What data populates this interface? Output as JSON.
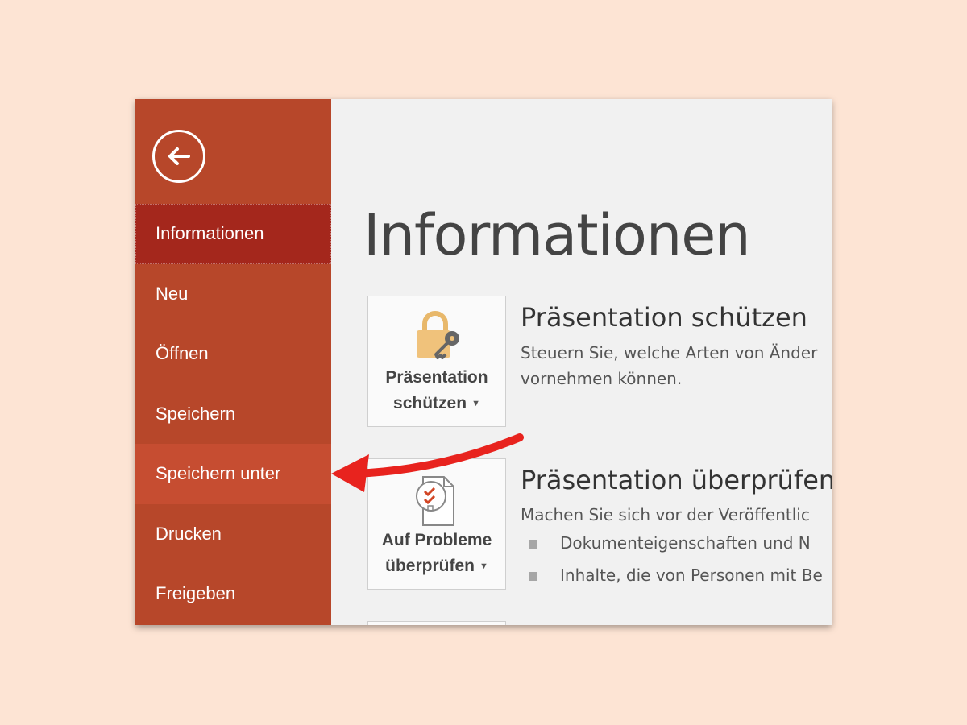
{
  "colors": {
    "background": "#fde4d4",
    "sidebar": "#b7472a",
    "sidebar_active": "#a4271c",
    "sidebar_highlight": "#c64d31",
    "annotation_arrow": "#e8231e"
  },
  "sidebar": {
    "back_icon": "back-arrow-icon",
    "items": [
      {
        "label": "Informationen"
      },
      {
        "label": "Neu"
      },
      {
        "label": "Öffnen"
      },
      {
        "label": "Speichern"
      },
      {
        "label": "Speichern unter"
      },
      {
        "label": "Drucken"
      },
      {
        "label": "Freigeben"
      }
    ]
  },
  "main": {
    "title": "Informationen",
    "sections": [
      {
        "tile_icon": "lock-key-icon",
        "tile_label_line1": "Präsentation",
        "tile_label_line2": "schützen",
        "title": "Präsentation schützen",
        "desc_line1": "Steuern Sie, welche Arten von Änder",
        "desc_line2": "vornehmen können."
      },
      {
        "tile_icon": "document-check-icon",
        "tile_label_line1": "Auf Probleme",
        "tile_label_line2": "überprüfen",
        "title": "Präsentation überprüfen",
        "desc_line1": "Machen Sie sich vor der Veröffentlic",
        "bullets": [
          "Dokumenteigenschaften und N",
          "Inhalte, die von Personen mit Be"
        ]
      }
    ]
  }
}
